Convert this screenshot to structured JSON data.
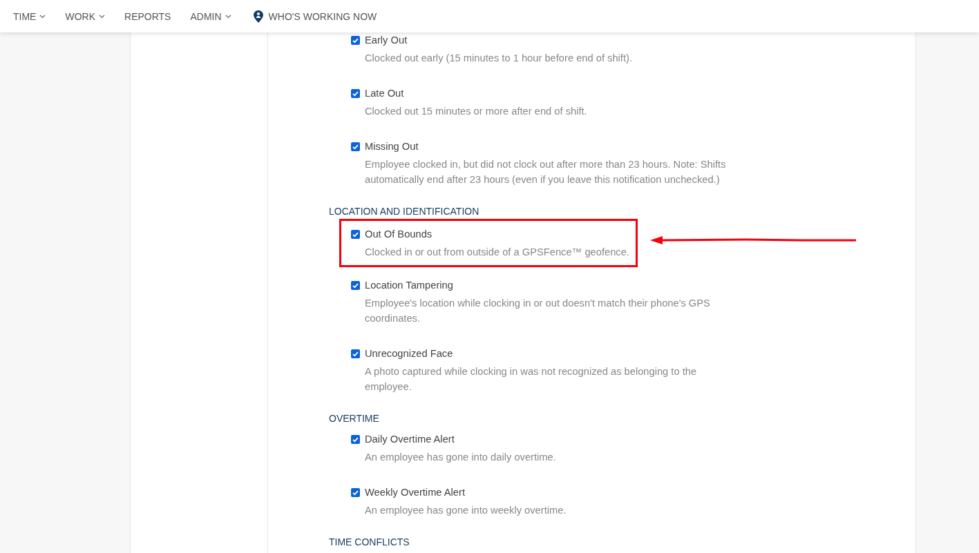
{
  "nav": [
    {
      "label": "TIME",
      "kind": "dropdown"
    },
    {
      "label": "WORK",
      "kind": "dropdown"
    },
    {
      "label": "REPORTS",
      "kind": "link"
    },
    {
      "label": "ADMIN",
      "kind": "dropdown"
    },
    {
      "label": "WHO'S WORKING NOW",
      "kind": "location"
    }
  ],
  "sections": [
    {
      "items": [
        {
          "label": "Early Out",
          "checked": true,
          "description": "Clocked out early (15 minutes to 1 hour before end of shift)."
        },
        {
          "label": "Late Out",
          "checked": true,
          "description": "Clocked out 15 minutes or more after end of shift."
        },
        {
          "label": "Missing Out",
          "checked": true,
          "description": "Employee clocked in, but did not clock out after more than 23 hours. Note: Shifts automatically end after 23 hours (even if you leave this notification unchecked.)"
        }
      ]
    },
    {
      "title": "LOCATION AND IDENTIFICATION",
      "items": [
        {
          "label": "Out Of Bounds",
          "checked": true,
          "highlighted": true,
          "description": "Clocked in or out from outside of a GPSFence™ geofence."
        },
        {
          "label": "Location Tampering",
          "checked": true,
          "description": "Employee's location while clocking in or out doesn't match their phone's GPS coordinates."
        },
        {
          "label": "Unrecognized Face",
          "checked": true,
          "description": "A photo captured while clocking in was not recognized as belonging to the employee."
        }
      ]
    },
    {
      "title": "OVERTIME",
      "items": [
        {
          "label": "Daily Overtime Alert",
          "checked": true,
          "description": "An employee has gone into daily overtime."
        },
        {
          "label": "Weekly Overtime Alert",
          "checked": true,
          "description": "An employee has gone into weekly overtime."
        }
      ]
    },
    {
      "title": "TIME CONFLICTS"
    }
  ]
}
